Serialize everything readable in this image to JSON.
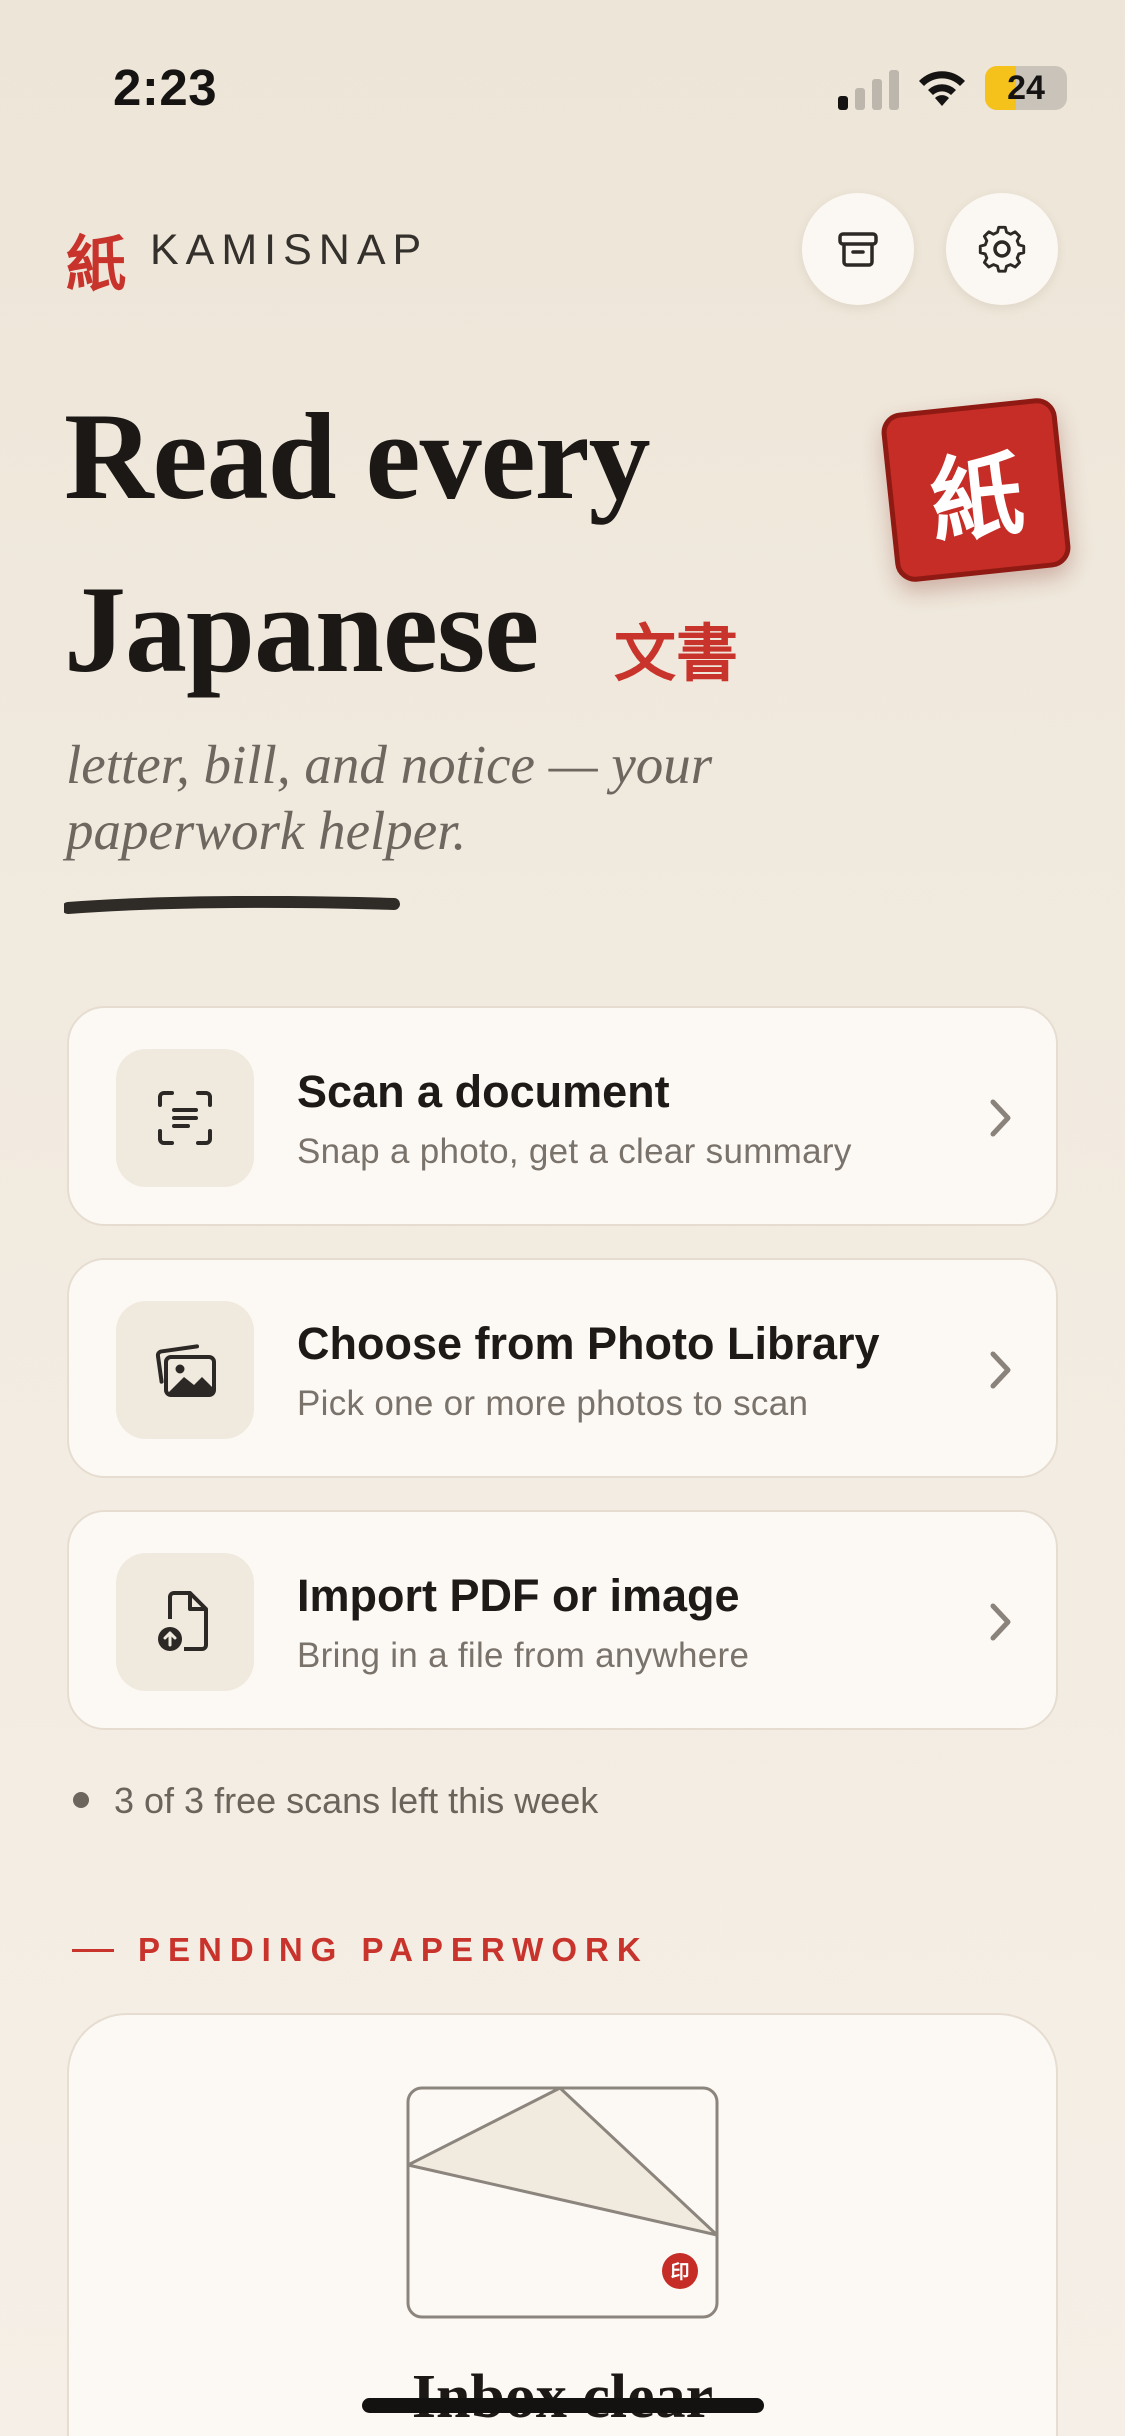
{
  "status_bar": {
    "time": "2:23",
    "battery": "24",
    "battery_level_percent": 24
  },
  "header": {
    "brand_mark": "紙",
    "brand_name": "KAMISNAP",
    "archive_icon": "archive-box-icon",
    "settings_icon": "gear-icon"
  },
  "hero": {
    "line1": "Read every",
    "line2": "Japanese",
    "kanji": "文書",
    "subtitle": "letter, bill, and notice — your paperwork helper.",
    "stamp": "紙"
  },
  "actions": [
    {
      "title": "Scan a document",
      "subtitle": "Snap a photo, get a clear summary",
      "icon": "document-scan-icon"
    },
    {
      "title": "Choose from Photo Library",
      "subtitle": "Pick one or more photos to scan",
      "icon": "photo-library-icon"
    },
    {
      "title": "Import PDF or image",
      "subtitle": "Bring in a file from anywhere",
      "icon": "file-import-icon"
    }
  ],
  "quota": {
    "text": "3 of 3 free scans left this week"
  },
  "pending": {
    "section_label": "PENDING PAPERWORK",
    "seal": "印",
    "empty_title": "Inbox clear"
  },
  "colors": {
    "accent": "#c8332c",
    "background": "#efe7dc",
    "card": "#fcf9f5",
    "text": "#1b1815",
    "muted": "#7a736b"
  }
}
